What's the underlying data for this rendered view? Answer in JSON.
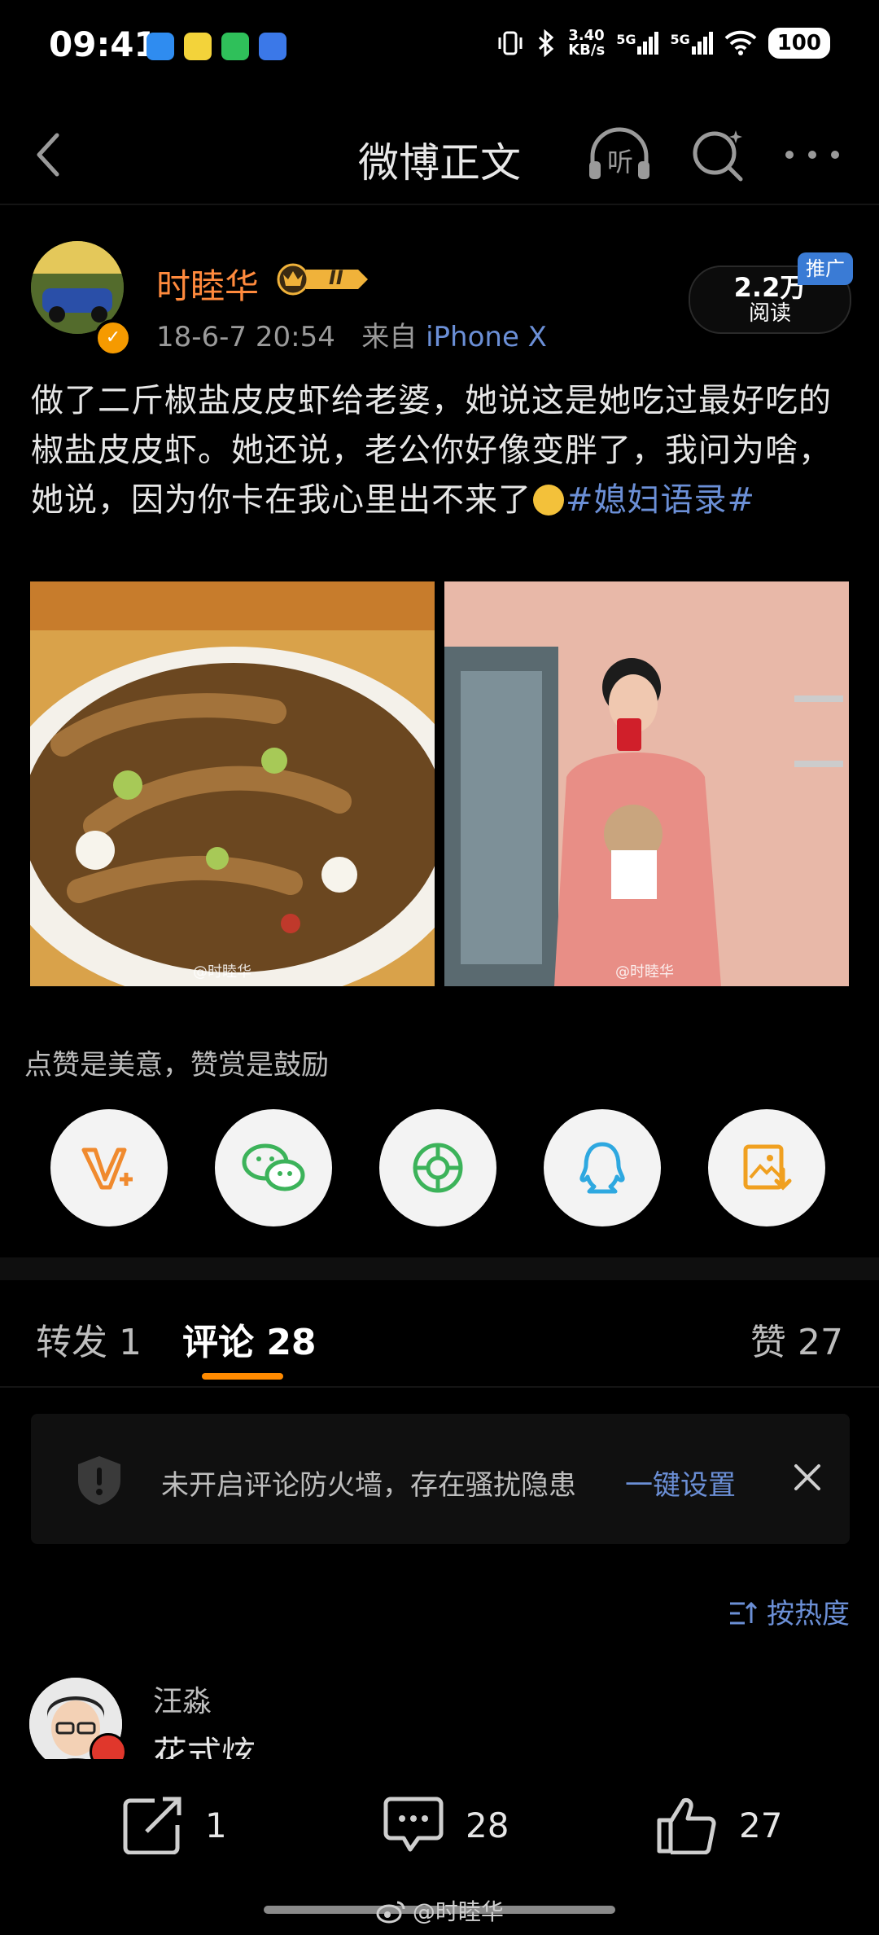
{
  "status_bar": {
    "time": "09:41",
    "speed": "3.40",
    "speed_unit": "KB/s",
    "net1": "5G",
    "net2": "5G",
    "battery": "100"
  },
  "nav": {
    "title": "微博正文",
    "listen_label": "听"
  },
  "post": {
    "author": "时睦华",
    "level": "II",
    "date": "18-6-7 20:54",
    "source_prefix": "来自",
    "source_device": "iPhone X",
    "reads_count": "2.2万",
    "reads_label": "阅读",
    "promo_badge": "推广",
    "text": "做了二斤椒盐皮皮虾给老婆，她说这是她吃过最好吃的椒盐皮皮虾。她还说，老公你好像变胖了，我问为啥，她说，因为你卡在我心里出不来了",
    "hashtag": "#媳妇语录#",
    "watermark_1": "@时睦华",
    "watermark_2": "@时睦华"
  },
  "reward": {
    "text": "点赞是美意，赞赏是鼓励"
  },
  "share_targets": [
    "vplus-icon",
    "wechat-icon",
    "moments-icon",
    "qq-icon",
    "save-image-icon"
  ],
  "tabs": {
    "repost": "转发 1",
    "comments": "评论 28",
    "likes": "赞 27"
  },
  "notice": {
    "text": "未开启评论防火墙，存在骚扰隐患",
    "link": "一键设置"
  },
  "sort": {
    "label": "按热度"
  },
  "comment": {
    "name": "汪淼",
    "body": "花式炫"
  },
  "bottom_bar": {
    "repost_count": "1",
    "comment_count": "28",
    "like_count": "27",
    "watermark": "@时睦华"
  },
  "colors": {
    "accent_orange": "#ff8a00",
    "link_blue": "#6b8fd6",
    "author_orange": "#ff8a3d"
  }
}
